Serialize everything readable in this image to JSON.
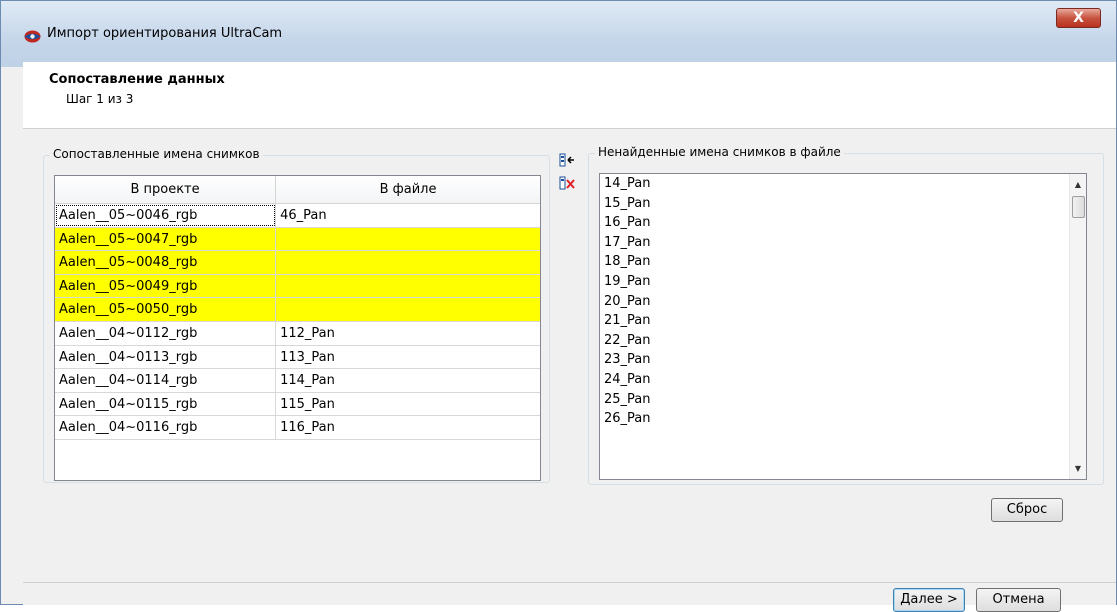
{
  "window": {
    "title": "Импорт ориентирования UltraCam",
    "close_label": "X"
  },
  "header": {
    "step_title": "Сопоставление данных",
    "step_subtitle": "Шаг 1 из 3"
  },
  "matched": {
    "group_label": "Сопоставленные имена снимков",
    "columns": [
      "В проекте",
      "В файле"
    ],
    "rows": [
      {
        "project": "Aalen__05~0046_rgb",
        "file": "46_Pan",
        "missing": false
      },
      {
        "project": "Aalen__05~0047_rgb",
        "file": "",
        "missing": true
      },
      {
        "project": "Aalen__05~0048_rgb",
        "file": "",
        "missing": true
      },
      {
        "project": "Aalen__05~0049_rgb",
        "file": "",
        "missing": true
      },
      {
        "project": "Aalen__05~0050_rgb",
        "file": "",
        "missing": true
      },
      {
        "project": "Aalen__04~0112_rgb",
        "file": "112_Pan",
        "missing": false
      },
      {
        "project": "Aalen__04~0113_rgb",
        "file": "113_Pan",
        "missing": false
      },
      {
        "project": "Aalen__04~0114_rgb",
        "file": "114_Pan",
        "missing": false
      },
      {
        "project": "Aalen__04~0115_rgb",
        "file": "115_Pan",
        "missing": false
      },
      {
        "project": "Aalen__04~0116_rgb",
        "file": "116_Pan",
        "missing": false
      }
    ],
    "highlight_color": "#ffff00"
  },
  "unmatched": {
    "group_label": "Ненайденные имена снимков в файле",
    "items": [
      "14_Pan",
      "15_Pan",
      "16_Pan",
      "17_Pan",
      "18_Pan",
      "19_Pan",
      "20_Pan",
      "21_Pan",
      "22_Pan",
      "23_Pan",
      "24_Pan",
      "25_Pan",
      "26_Pan"
    ],
    "scroll_up_glyph": "▲",
    "scroll_down_glyph": "▼"
  },
  "actions": {
    "assign_icon": "link-arrow-icon",
    "remove_icon": "unlink-x-icon",
    "reset_label": "Сброс",
    "next_label": "Далее >",
    "cancel_label": "Отмена"
  }
}
